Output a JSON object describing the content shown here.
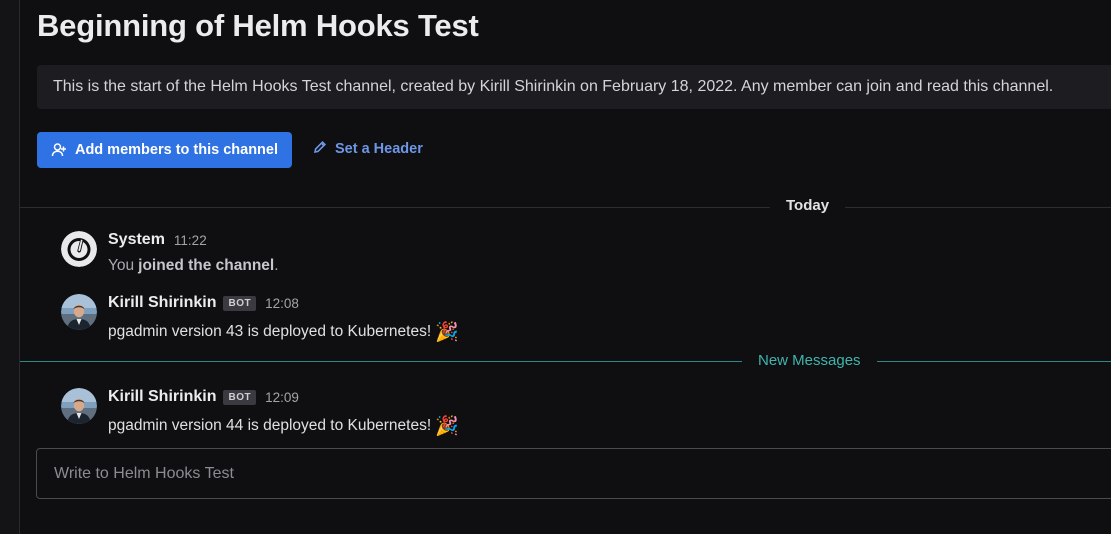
{
  "channel_intro": {
    "title": "Beginning of Helm Hooks Test",
    "description": "This is the start of the Helm Hooks Test channel, created by Kirill Shirinkin on February 18, 2022. Any member can join and read this channel.",
    "add_members_label": "Add members to this channel",
    "set_header_label": "Set a Header"
  },
  "date_separator": "Today",
  "posts": [
    {
      "author": "System",
      "time": "11:22",
      "body_prefix": "You",
      "body_bold": "joined the channel",
      "body_suffix": "."
    },
    {
      "author": "Kirill Shirinkin",
      "badge": "BOT",
      "time": "12:08",
      "body": "pgadmin version 43 is deployed to Kubernetes!",
      "emoji": "🎉"
    },
    {
      "author": "Kirill Shirinkin",
      "badge": "BOT",
      "time": "12:09",
      "body": "pgadmin version 44 is deployed to Kubernetes!",
      "emoji": "🎉"
    }
  ],
  "new_messages_label": "New Messages",
  "composer": {
    "placeholder": "Write to Helm Hooks Test",
    "value": ""
  },
  "colors": {
    "background": "#0f0f11",
    "primary_button": "#2f72e3",
    "link": "#6e96e6",
    "new_messages": "#3fb5ad"
  },
  "icons": {
    "add_members": "add-user-icon",
    "set_header": "pencil-icon",
    "system_avatar": "mattermost-logo-icon",
    "user_avatar": "user-photo-avatar",
    "emoji": "party-popper-emoji"
  }
}
